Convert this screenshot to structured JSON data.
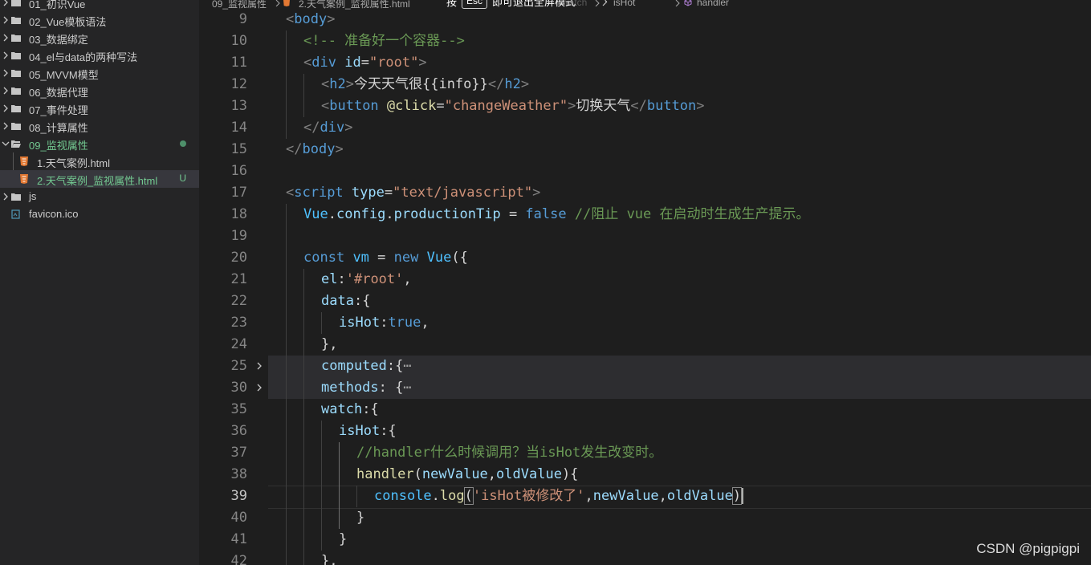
{
  "colors": {
    "sidebar_bg": "#252526",
    "editor_bg": "#1e1e1e",
    "modified_green": "#73c991",
    "html_icon": "#e37933",
    "tag": "#569cd6",
    "attr": "#9cdcfe",
    "string": "#ce9178",
    "comment": "#6a9955",
    "function": "#dcdcaa"
  },
  "explorer": {
    "items": [
      {
        "label": "01_初识Vue",
        "type": "folder",
        "icon": "folder-icon",
        "expanded": false
      },
      {
        "label": "02_Vue模板语法",
        "type": "folder",
        "icon": "folder-icon",
        "expanded": false
      },
      {
        "label": "03_数据绑定",
        "type": "folder",
        "icon": "folder-icon",
        "expanded": false
      },
      {
        "label": "04_el与data的两种写法",
        "type": "folder",
        "icon": "folder-icon",
        "expanded": false
      },
      {
        "label": "05_MVVM模型",
        "type": "folder",
        "icon": "folder-icon",
        "expanded": false
      },
      {
        "label": "06_数据代理",
        "type": "folder",
        "icon": "folder-icon",
        "expanded": false
      },
      {
        "label": "07_事件处理",
        "type": "folder",
        "icon": "folder-icon",
        "expanded": false
      },
      {
        "label": "08_计算属性",
        "type": "folder",
        "icon": "folder-icon",
        "expanded": false
      },
      {
        "label": "09_监视属性",
        "type": "folder",
        "icon": "folder-open-icon",
        "expanded": true
      },
      {
        "label": "1.天气案例.html",
        "type": "file",
        "icon": "html-file-icon"
      },
      {
        "label": "2.天气案例_监视属性.html",
        "type": "file",
        "icon": "html-file-icon",
        "decoration": "U"
      },
      {
        "label": "js",
        "type": "folder",
        "icon": "folder-icon",
        "expanded": false
      },
      {
        "label": "favicon.ico",
        "type": "file",
        "icon": "image-file-icon"
      }
    ]
  },
  "breadcrumb": {
    "folder": "09_监视属性",
    "file": "2.天气案例_监视属性.html",
    "seg_watch": "watch",
    "seg_ishot": "isHot",
    "seg_handler": "handler"
  },
  "fullscreen_hint": {
    "prefix": "按",
    "key": "Esc",
    "suffix": "即可退出全屏模式"
  },
  "editor": {
    "current_line": "39",
    "lines": [
      {
        "num": "9"
      },
      {
        "num": "10"
      },
      {
        "num": "11"
      },
      {
        "num": "12"
      },
      {
        "num": "13"
      },
      {
        "num": "14"
      },
      {
        "num": "15"
      },
      {
        "num": "16"
      },
      {
        "num": "17"
      },
      {
        "num": "18"
      },
      {
        "num": "19"
      },
      {
        "num": "20"
      },
      {
        "num": "21"
      },
      {
        "num": "22"
      },
      {
        "num": "23"
      },
      {
        "num": "24"
      },
      {
        "num": "25"
      },
      {
        "num": "30"
      },
      {
        "num": "35"
      },
      {
        "num": "36"
      },
      {
        "num": "37"
      },
      {
        "num": "38"
      },
      {
        "num": "39"
      },
      {
        "num": "40"
      },
      {
        "num": "41"
      },
      {
        "num": "42"
      }
    ],
    "tokens": {
      "body": "body",
      "comment_container": "<!-- 准备好一个容器-->",
      "div": "div",
      "id_attr": "id",
      "root_str": "\"root\"",
      "h2": "h2",
      "h2_text": "今天天气很{{info}}",
      "button": "button",
      "click_attr": "@click",
      "change_str": "\"changeWeather\"",
      "button_text": "切换天气",
      "script": "script",
      "type_attr": "type",
      "type_str": "\"text/javascript\"",
      "vue": "Vue",
      "config": "config",
      "productionTip": "productionTip",
      "false_kw": "false",
      "comment_tip": "//阻止 vue 在启动时生成生产提示。",
      "const_kw": "const",
      "vm": "vm",
      "new_kw": "new",
      "el_key": "el",
      "root_sel": "'#root'",
      "data_key": "data",
      "isHot_key": "isHot",
      "true_kw": "true",
      "computed_key": "computed",
      "methods_key": "methods",
      "watch_key": "watch",
      "comment_handler": "//handler什么时候调用？当isHot发生改变时。",
      "handler_fn": "handler",
      "newValue": "newValue",
      "oldValue": "oldValue",
      "console": "console",
      "log": "log",
      "log_str": "'isHot被修改了'",
      "ellipsis": "⋯"
    }
  },
  "watermark": "CSDN @pigpigpi"
}
